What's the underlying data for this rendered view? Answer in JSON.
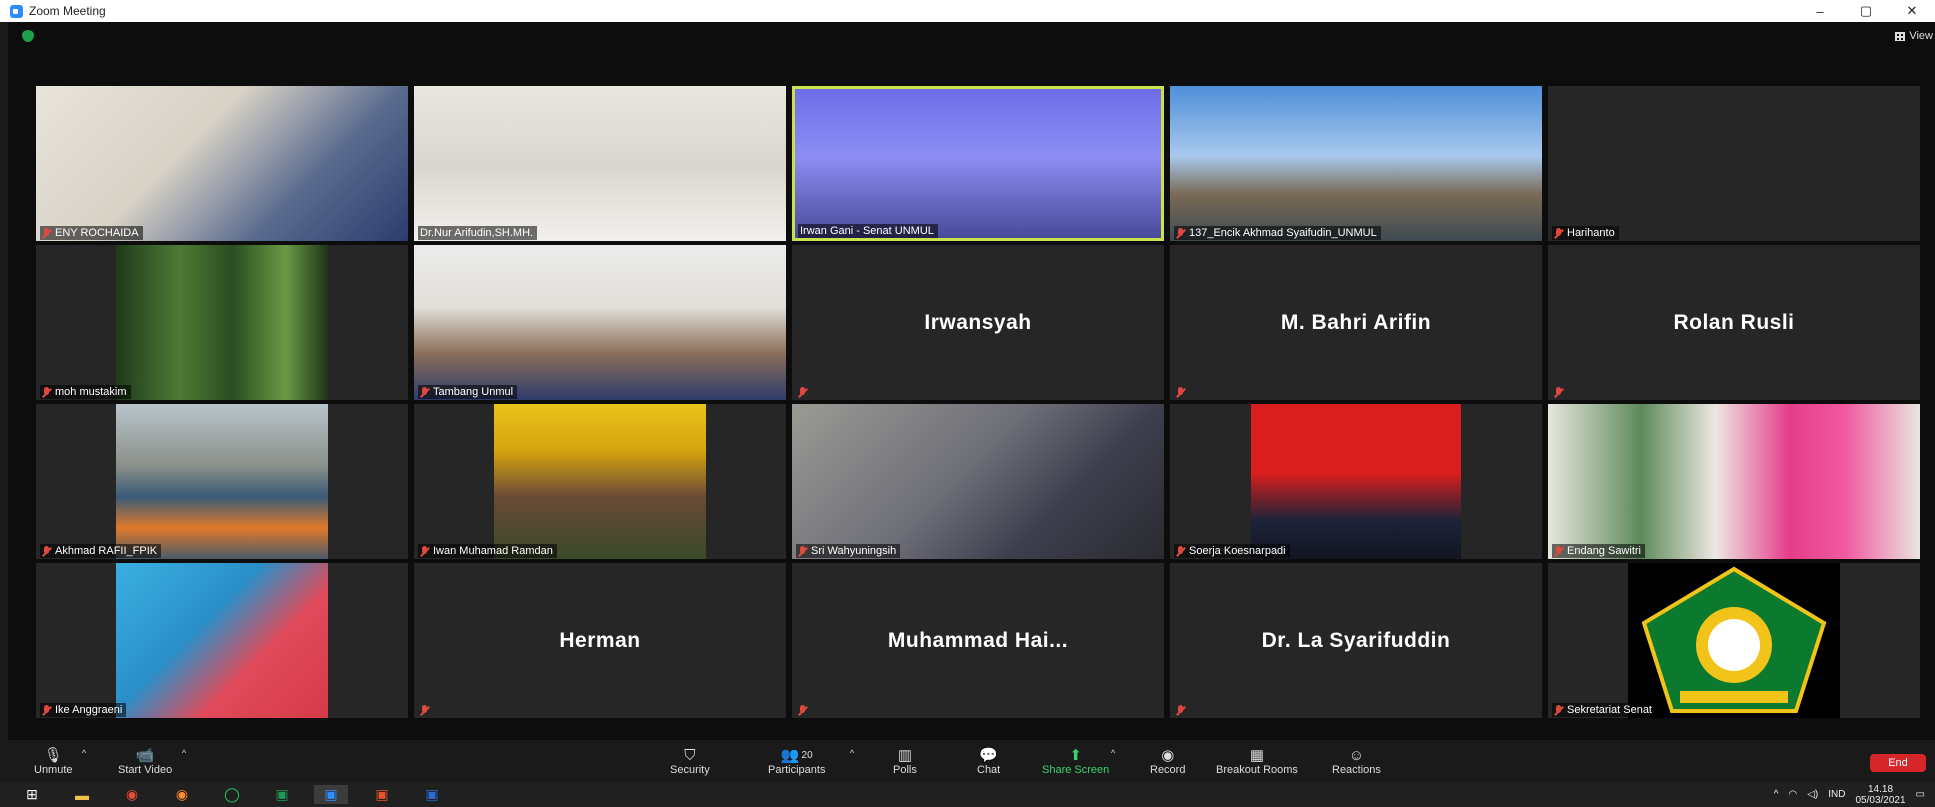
{
  "window": {
    "title": "Zoom Meeting",
    "min": "–",
    "max": "▢",
    "close": "✕"
  },
  "view_label": "View",
  "participants": [
    {
      "name": "ENY ROCHAIDA",
      "muted": true,
      "video": true
    },
    {
      "name": "Dr.Nur Arifudin,SH.MH.",
      "muted": false,
      "video": true
    },
    {
      "name": "Irwan Gani - Senat UNMUL",
      "muted": false,
      "video": true,
      "active": true
    },
    {
      "name": "137_Encik Akhmad Syaifudin_UNMUL",
      "muted": true,
      "video": true
    },
    {
      "name": "Harihanto",
      "muted": true,
      "video": false,
      "display": ""
    },
    {
      "name": "moh mustakim",
      "muted": true,
      "video": true
    },
    {
      "name": "Tambang Unmul",
      "muted": true,
      "video": true
    },
    {
      "name": "",
      "muted": true,
      "video": false,
      "display": "Irwansyah"
    },
    {
      "name": "",
      "muted": true,
      "video": false,
      "display": "M. Bahri Arifin"
    },
    {
      "name": "",
      "muted": true,
      "video": false,
      "display": "Rolan Rusli"
    },
    {
      "name": "Akhmad RAFII_FPIK",
      "muted": true,
      "video": true
    },
    {
      "name": "Iwan Muhamad Ramdan",
      "muted": true,
      "video": true
    },
    {
      "name": "Sri Wahyuningsih",
      "muted": true,
      "video": true
    },
    {
      "name": "Soerja Koesnarpadi",
      "muted": true,
      "video": true
    },
    {
      "name": "Endang Sawitri",
      "muted": true,
      "video": true
    },
    {
      "name": "Ike Anggraeni",
      "muted": true,
      "video": true
    },
    {
      "name": "",
      "muted": true,
      "video": false,
      "display": "Herman"
    },
    {
      "name": "",
      "muted": true,
      "video": false,
      "display": "Muhammad  Hai..."
    },
    {
      "name": "",
      "muted": true,
      "video": false,
      "display": "Dr. La Syarifuddin"
    },
    {
      "name": "Sekretariat Senat",
      "muted": true,
      "video": true
    }
  ],
  "toolbar": {
    "unmute": "Unmute",
    "start_video": "Start Video",
    "security": "Security",
    "participants": "Participants",
    "participants_count": "20",
    "polls": "Polls",
    "chat": "Chat",
    "share_screen": "Share Screen",
    "record": "Record",
    "breakout_rooms": "Breakout Rooms",
    "reactions": "Reactions",
    "end": "End"
  },
  "taskbar": {
    "language": "IND",
    "time": "14.18",
    "date": "05/03/2021"
  },
  "colors": {
    "active_speaker_border": "#c9e24b",
    "muted_red": "#e0483e",
    "share_green": "#3bd16f",
    "end_red": "#d7262a"
  }
}
